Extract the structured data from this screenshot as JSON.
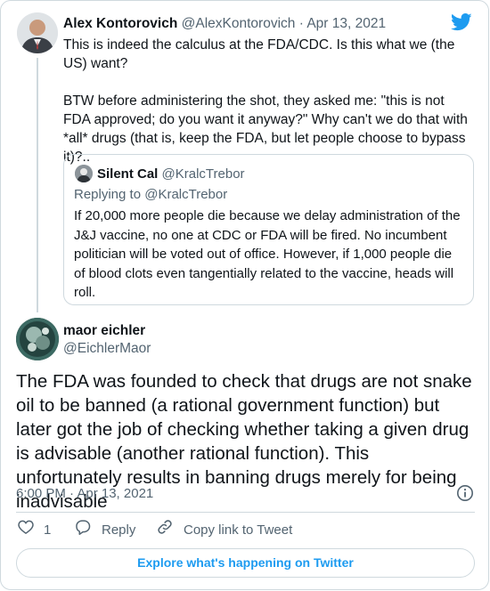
{
  "parent_tweet": {
    "author_name": "Alex Kontorovich",
    "author_handle": "@AlexKontorovich",
    "separator": "·",
    "date": "Apr 13, 2021",
    "text": "This is indeed the calculus at the FDA/CDC. Is this what we (the US) want?\n\nBTW before administering the shot, they asked me: \"this is not FDA approved; do you want it anyway?\" Why can't we do that with *all* drugs (that is, keep the FDA, but let people choose to bypass it)?.."
  },
  "quoted_tweet": {
    "author_name": "Silent Cal",
    "author_handle": "@KralcTrebor",
    "replying_to": "Replying to @KralcTrebor",
    "text": "If 20,000 more people die because we delay administration of the J&J vaccine, no one at CDC or FDA will be fired. No incumbent politician will be voted out of office. However, if 1,000 people die of blood clots even tangentially related to the vaccine, heads will roll."
  },
  "main_tweet": {
    "author_name": "maor eichler",
    "author_handle": "@EichlerMaor",
    "text": "The FDA was founded to check that drugs are not snake oil to be banned (a rational government function) but later got the job of checking whether taking a given drug is advisable (another rational function). This unfortunately results in banning drugs merely for being inadvisable",
    "timestamp": "6:00 PM · Apr 13, 2021"
  },
  "actions": {
    "like_count": "1",
    "reply_label": "Reply",
    "copy_link_label": "Copy link to Tweet"
  },
  "footer": {
    "explore_label": "Explore what's happening on Twitter"
  },
  "icons": {
    "brand": "twitter-bird-icon",
    "like": "heart-icon",
    "reply": "speech-bubble-icon",
    "copy_link": "link-icon",
    "info": "info-icon"
  },
  "colors": {
    "accent": "#1d9bf0",
    "text": "#0f1419",
    "muted": "#536471",
    "border": "#cfd9de"
  }
}
